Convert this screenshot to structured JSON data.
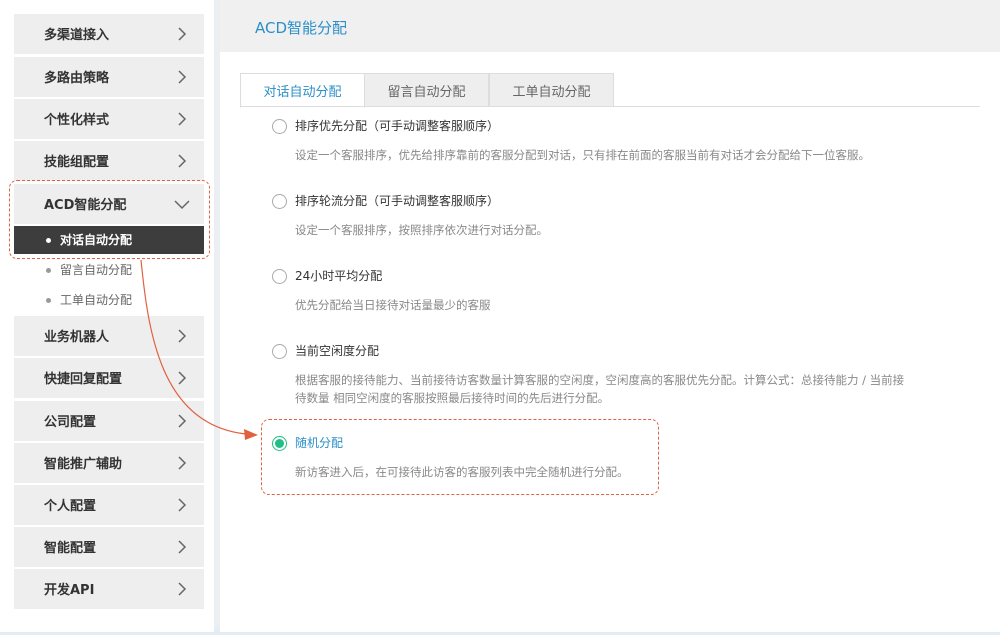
{
  "sidebar": {
    "items": [
      {
        "label": "多渠道接入"
      },
      {
        "label": "多路由策略"
      },
      {
        "label": "个性化样式"
      },
      {
        "label": "技能组配置"
      },
      {
        "label": "ACD智能分配"
      },
      {
        "label": "业务机器人"
      },
      {
        "label": "快捷回复配置"
      },
      {
        "label": "公司配置"
      },
      {
        "label": "智能推广辅助"
      },
      {
        "label": "个人配置"
      },
      {
        "label": "智能配置"
      },
      {
        "label": "开发API"
      }
    ],
    "sub_items": [
      {
        "label": "对话自动分配"
      },
      {
        "label": "留言自动分配"
      },
      {
        "label": "工单自动分配"
      }
    ]
  },
  "main": {
    "title": "ACD智能分配",
    "tabs": [
      {
        "label": "对话自动分配"
      },
      {
        "label": "留言自动分配"
      },
      {
        "label": "工单自动分配"
      }
    ],
    "options": [
      {
        "title": "排序优先分配（可手动调整客服顺序）",
        "desc": "设定一个客服排序，优先给排序靠前的客服分配到对话，只有排在前面的客服当前有对话才会分配给下一位客服。"
      },
      {
        "title": "排序轮流分配（可手动调整客服顺序）",
        "desc": "设定一个客服排序，按照排序依次进行对话分配。"
      },
      {
        "title": "24小时平均分配",
        "desc": "优先分配给当日接待对话量最少的客服"
      },
      {
        "title": "当前空闲度分配",
        "desc": "根据客服的接待能力、当前接待访客数量计算客服的空闲度，空闲度高的客服优先分配。计算公式：总接待能力 / 当前接待数量 相同空闲度的客服按照最后接待时间的先后进行分配。"
      },
      {
        "title": "随机分配",
        "desc": "新访客进入后，在可接待此访客的客服列表中完全随机进行分配。"
      }
    ],
    "selected_option": "随机分配"
  },
  "colors": {
    "accent": "#2b8fc7",
    "radio_checked": "#1fbf87",
    "annotation": "#e0603f",
    "active_sub_bg": "#3d3d3d"
  }
}
